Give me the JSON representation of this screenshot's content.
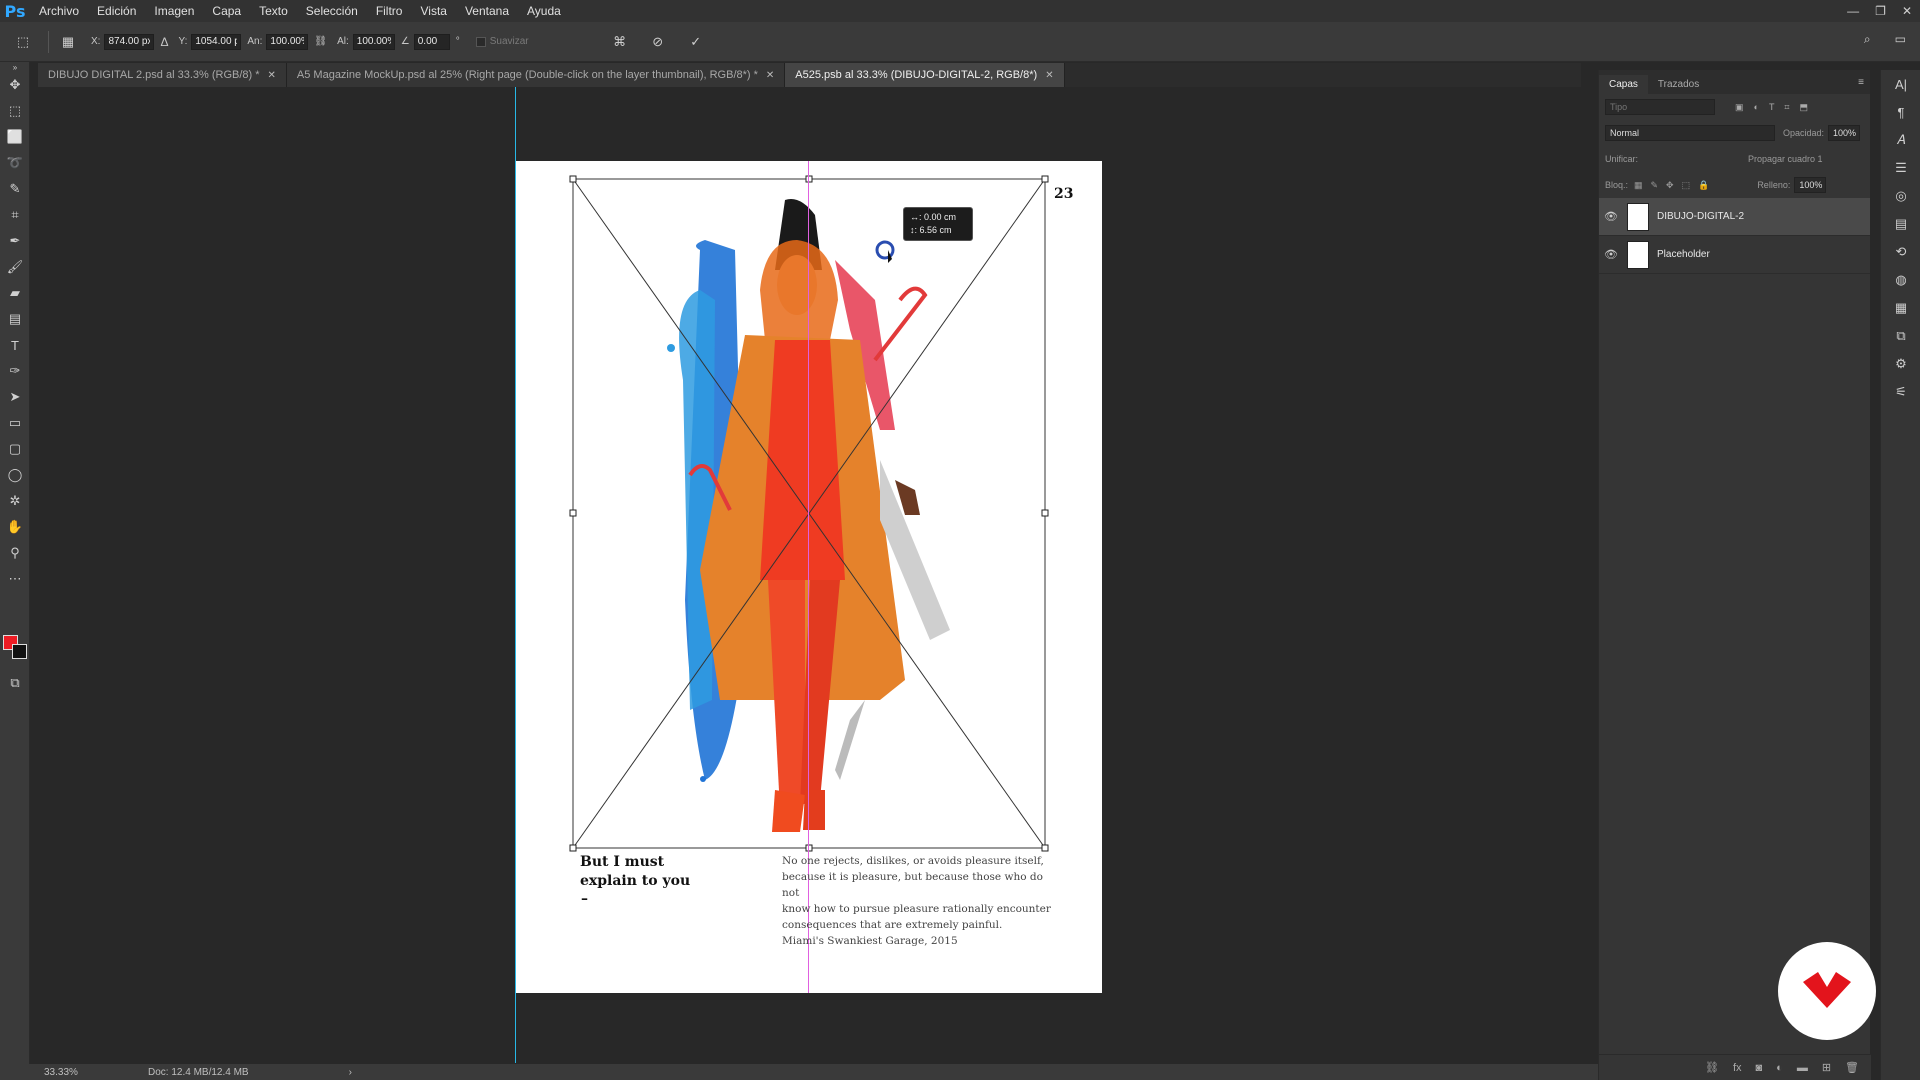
{
  "app": {
    "logo": "Ps"
  },
  "menu": [
    "Archivo",
    "Edición",
    "Imagen",
    "Capa",
    "Texto",
    "Selección",
    "Filtro",
    "Vista",
    "Ventana",
    "Ayuda"
  ],
  "options": {
    "x_label": "X:",
    "x_value": "874.00 px",
    "y_label": "Y:",
    "y_value": "1054.00 p:",
    "w_label": "An:",
    "w_value": "100.00%",
    "h_label": "Al:",
    "h_value": "100.00%",
    "angle_value": "0.00",
    "angle_unit": "°",
    "smooth_label": "Suavizar"
  },
  "tabs": [
    {
      "label": "DIBUJO DIGITAL 2.psd al 33.3% (RGB/8) *",
      "active": false
    },
    {
      "label": "A5 Magazine MockUp.psd al 25% (Right page (Double-click on the layer thumbnail), RGB/8*) *",
      "active": false
    },
    {
      "label": "A525.psb al 33.3% (DIBUJO-DIGITAL-2, RGB/8*)",
      "active": true
    }
  ],
  "document": {
    "page_number": "23",
    "headline_line1": "But I must",
    "headline_line2": "explain to you",
    "headline_dash": "–",
    "body_lines": [
      "No one rejects, dislikes, or avoids pleasure itself,",
      "because it is pleasure, but because those who do not",
      "know how to pursue pleasure rationally encounter",
      "consequences that are extremely painful."
    ],
    "caption": "Miami's Swankiest Garage, 2015",
    "tooltip_line1": "↔:  0.00 cm",
    "tooltip_line2": "↕:  6.56 cm"
  },
  "layers_panel": {
    "tabs": [
      "Capas",
      "Trazados"
    ],
    "search_placeholder": "Tipo",
    "blend_mode": "Normal",
    "opacity_label": "Opacidad:",
    "opacity_value": "100%",
    "unify_label": "Unificar:",
    "propagate_label": "Propagar cuadro 1",
    "lock_label": "Bloq.:",
    "fill_label": "Relleno:",
    "fill_value": "100%",
    "layers": [
      {
        "name": "DIBUJO-DIGITAL-2",
        "selected": true
      },
      {
        "name": "Placeholder",
        "selected": false
      }
    ]
  },
  "status": {
    "zoom": "33.33%",
    "doc_size": "Doc: 12.4 MB/12.4 MB"
  },
  "colors": {
    "foreground": "#ed1c24",
    "background": "#111111",
    "accent": "#31a8ff",
    "brand": "#e3141c"
  }
}
